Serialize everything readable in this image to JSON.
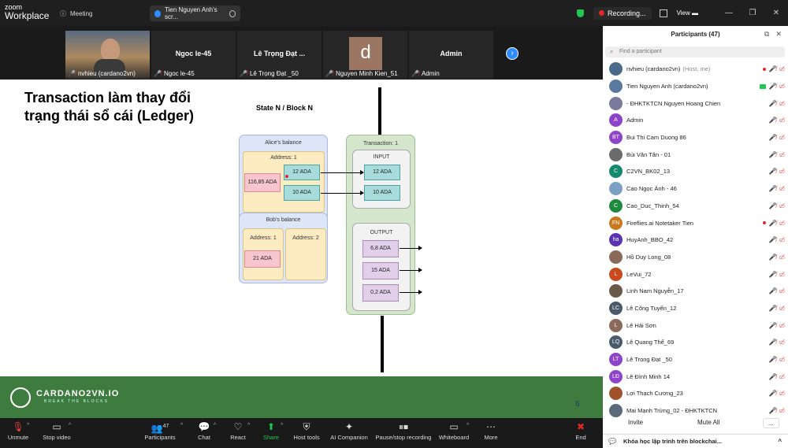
{
  "app": {
    "logo_top": "zoom",
    "logo_bottom": "Workplace",
    "meeting_label": "Meeting",
    "share_label": "Tien Nguyen Anh's scr...",
    "recording_label": "Recording...",
    "view_label": "View"
  },
  "strip": [
    {
      "name": "",
      "caption": "nvhieu (cardano2vn)",
      "type": "photo"
    },
    {
      "name": "Ngoc le-45",
      "caption": "Ngoc le-45",
      "type": "name"
    },
    {
      "name": "Lê Trọng Đạt  ...",
      "caption": "Lê Trọng Đạt _50",
      "type": "name"
    },
    {
      "name": "d",
      "caption": "Nguyen Minh Kien_51",
      "type": "avatar"
    },
    {
      "name": "Admin",
      "caption": "Admin",
      "type": "name"
    }
  ],
  "slide": {
    "title_line1": "Transaction làm thay đổi",
    "title_line2": "trạng thái sổ cái (Ledger)",
    "state": "State N / Block N",
    "alice": "Alice's balance",
    "alice_addr": "Address: 1",
    "ada_a": "116,85 ADA",
    "ada_b": "12 ADA",
    "ada_c": "10 ADA",
    "bob": "Bob's balance",
    "bob_addr1": "Address: 1",
    "bob_addr2": "Address: 2",
    "bob_ada": "21 ADA",
    "tx": "Transaction: 1",
    "input": "INPUT",
    "in1": "12 ADA",
    "in2": "10 ADA",
    "output": "OUTPUT",
    "out1": "6,8 ADA",
    "out2": "15 ADA",
    "out3": "0,2 ADA",
    "brand": "CARDANO2VN.IO",
    "tagline": "BREAK THE BLOCKS",
    "page": "6"
  },
  "toolbar": [
    {
      "label": "Unmute",
      "icon": "mic-off-icon",
      "glyph": "🎙"
    },
    {
      "label": "Stop video",
      "icon": "video-icon",
      "glyph": "▭"
    },
    {
      "label": "Participants",
      "icon": "participants-icon",
      "glyph": "👥",
      "count": "47"
    },
    {
      "label": "Chat",
      "icon": "chat-icon",
      "glyph": "💬"
    },
    {
      "label": "React",
      "icon": "heart-icon",
      "glyph": "♡"
    },
    {
      "label": "Share",
      "icon": "share-icon",
      "glyph": "⬆"
    },
    {
      "label": "Host tools",
      "icon": "shield-icon",
      "glyph": "⛨"
    },
    {
      "label": "AI Companion",
      "icon": "sparkle-icon",
      "glyph": "✦"
    },
    {
      "label": "Pause/stop recording",
      "icon": "pause-icon",
      "glyph": "⏸"
    },
    {
      "label": "Whiteboard",
      "icon": "whiteboard-icon",
      "glyph": "▭"
    },
    {
      "label": "More",
      "icon": "more-icon",
      "glyph": "⋯"
    },
    {
      "label": "End",
      "icon": "end-icon",
      "glyph": "✖"
    }
  ],
  "panel": {
    "title": "Participants (47)",
    "search_placeholder": "Find a participant",
    "invite": "Invite",
    "mute_all": "Mute All",
    "more": "...",
    "chat_title": "Khóa học lập trình trên blockchai...",
    "people": [
      {
        "name": "nvhieu (cardano2vn)",
        "note": "(Host, me)",
        "initials": "",
        "color": "#4a6a8a"
      },
      {
        "name": "Tien Nguyen Anh (cardano2vn)",
        "note": "",
        "initials": "",
        "color": "#5a7aa0"
      },
      {
        "name": "- ĐHKTKTCN Nguyen Hoang Chien",
        "note": "",
        "initials": "",
        "color": "#7a7a9a"
      },
      {
        "name": "Admin",
        "note": "",
        "initials": "A",
        "color": "#8e44c9"
      },
      {
        "name": "Bui Thi Cam Duong 86",
        "note": "",
        "initials": "BT",
        "color": "#8e44c9"
      },
      {
        "name": "Bùi Văn Tân - 01",
        "note": "",
        "initials": "",
        "color": "#6b6b6b"
      },
      {
        "name": "C2VN_BK02_13",
        "note": "",
        "initials": "C",
        "color": "#138a6e"
      },
      {
        "name": "Cao Ngọc Ánh - 46",
        "note": "",
        "initials": "",
        "color": "#7aa0c4"
      },
      {
        "name": "Cao_Duc_Thinh_54",
        "note": "",
        "initials": "C",
        "color": "#1e8a3e"
      },
      {
        "name": "Fireflies.ai Notetaker Tien",
        "note": "",
        "initials": "FN",
        "color": "#c9781e"
      },
      {
        "name": "HuyAnh_BBO_42",
        "note": "",
        "initials": "ha",
        "color": "#5a34b0"
      },
      {
        "name": "Hồ Duy Long_08",
        "note": "",
        "initials": "",
        "color": "#8a6a5a"
      },
      {
        "name": "LeVui_72",
        "note": "",
        "initials": "L",
        "color": "#c94a1e"
      },
      {
        "name": "Linh Nam Nguyễn_17",
        "note": "",
        "initials": "",
        "color": "#6a5a4a"
      },
      {
        "name": "Lê Công Tuyến_12",
        "note": "",
        "initials": "LC",
        "color": "#4a5a6a"
      },
      {
        "name": "Lê Hải Sơn",
        "note": "",
        "initials": "L",
        "color": "#8a6a5a"
      },
      {
        "name": "Lê Quang Thế_69",
        "note": "",
        "initials": "LQ",
        "color": "#4a5a6a"
      },
      {
        "name": "Lê Trọng Đạt _50",
        "note": "",
        "initials": "LT",
        "color": "#8e44c9"
      },
      {
        "name": "Lê Đình Minh 14",
        "note": "",
        "initials": "LĐ",
        "color": "#8e44c9"
      },
      {
        "name": "Lợi Thạch Cương_23",
        "note": "",
        "initials": "",
        "color": "#a0522d"
      },
      {
        "name": "Mai Mạnh Trừng_02 - ĐHKTKTCN",
        "note": "",
        "initials": "",
        "color": "#5a6a7a"
      }
    ]
  }
}
